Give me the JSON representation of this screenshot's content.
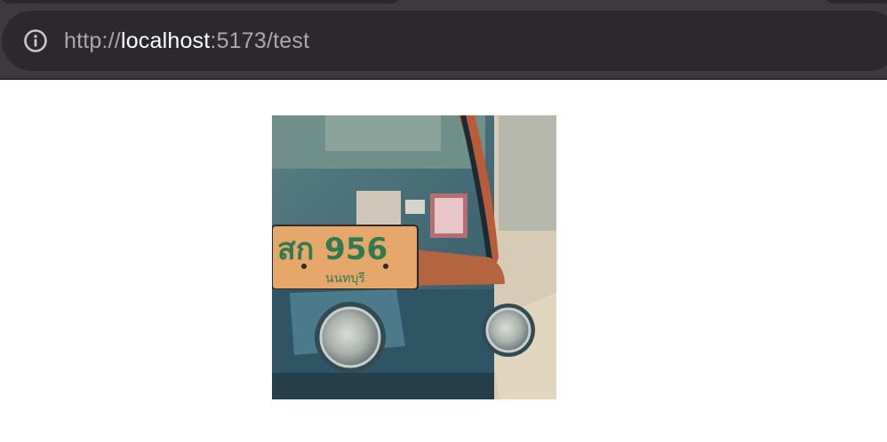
{
  "browser": {
    "address_bar": {
      "scheme": "http://",
      "host": "localhost",
      "path": ":5173/test",
      "icon": "info-icon"
    }
  },
  "page": {
    "image": {
      "subject": "auto rickshaw (tuk-tuk) front with license plate",
      "plate_text": "สก 956",
      "plate_province": "นนทบุรี",
      "plate_color": "#e6a76b",
      "plate_text_color": "#2f7a52"
    }
  }
}
